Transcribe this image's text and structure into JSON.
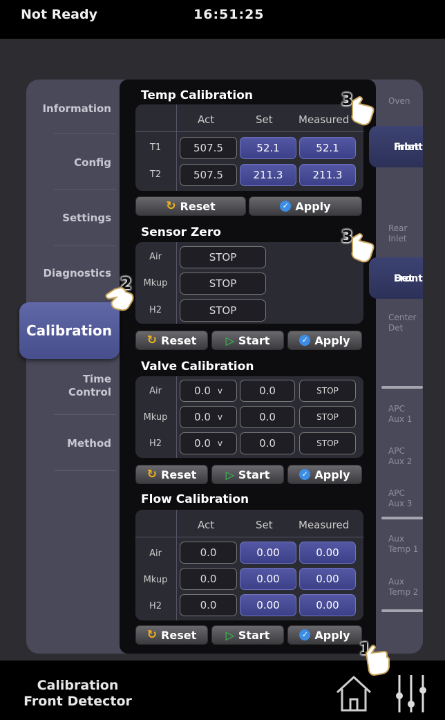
{
  "status": {
    "state": "Not Ready",
    "time": "16:51:25"
  },
  "left_nav": {
    "items": [
      {
        "label": "Information"
      },
      {
        "label": "Config"
      },
      {
        "label": "Settings"
      },
      {
        "label": "Diagnostics"
      },
      {
        "label": "Calibration",
        "active": true
      },
      {
        "label_line1": "Time",
        "label_line2": "Control"
      },
      {
        "label": "Method"
      }
    ]
  },
  "temp_calibration": {
    "title": "Temp Calibration",
    "columns": [
      "Act",
      "Set",
      "Measured"
    ],
    "rows": [
      {
        "label": "T1",
        "act": "507.5",
        "set": "52.1",
        "measured": "52.1"
      },
      {
        "label": "T2",
        "act": "507.5",
        "set": "211.3",
        "measured": "211.3"
      }
    ],
    "buttons": {
      "reset": "Reset",
      "apply": "Apply"
    }
  },
  "sensor_zero": {
    "title": "Sensor Zero",
    "rows": [
      {
        "label": "Air",
        "value": "STOP"
      },
      {
        "label": "Mkup",
        "value": "STOP"
      },
      {
        "label": "H2",
        "value": "STOP"
      }
    ],
    "buttons": {
      "reset": "Reset",
      "start": "Start",
      "apply": "Apply"
    }
  },
  "valve_calibration": {
    "title": "Valve Calibration",
    "rows": [
      {
        "label": "Air",
        "value": "0.0",
        "unit": "v",
        "reading": "0.0",
        "action": "STOP"
      },
      {
        "label": "Mkup",
        "value": "0.0",
        "unit": "v",
        "reading": "0.0",
        "action": "STOP"
      },
      {
        "label": "H2",
        "value": "0.0",
        "unit": "v",
        "reading": "0.0",
        "action": "STOP"
      }
    ],
    "buttons": {
      "reset": "Reset",
      "start": "Start",
      "apply": "Apply"
    }
  },
  "flow_calibration": {
    "title": "Flow Calibration",
    "columns": [
      "Act",
      "Set",
      "Measured"
    ],
    "rows": [
      {
        "label": "Air",
        "act": "0.0",
        "set": "0.00",
        "measured": "0.00"
      },
      {
        "label": "Mkup",
        "act": "0.0",
        "set": "0.00",
        "measured": "0.00"
      },
      {
        "label": "H2",
        "act": "0.0",
        "set": "0.00",
        "measured": "0.00"
      }
    ],
    "buttons": {
      "reset": "Reset",
      "start": "Start",
      "apply": "Apply"
    }
  },
  "right_nav": {
    "items": [
      {
        "line1": "Oven",
        "line2": ""
      },
      {
        "line1": "Front",
        "line2": "Inlet",
        "active": true
      },
      {
        "line1": "Rear",
        "line2": "Inlet"
      },
      {
        "line1": "Front",
        "line2": "Det",
        "active": true
      },
      {
        "line1": "Center",
        "line2": "Det"
      },
      {
        "line1": "APC",
        "line2": "Aux 1"
      },
      {
        "line1": "APC",
        "line2": "Aux 2"
      },
      {
        "line1": "APC",
        "line2": "Aux 3"
      },
      {
        "line1": "Aux",
        "line2": "Temp 1"
      },
      {
        "line1": "Aux",
        "line2": "Temp 2"
      }
    ]
  },
  "bottom": {
    "title_line1": "Calibration",
    "title_line2": "Front Detector"
  },
  "callouts": [
    "1",
    "2",
    "3",
    "3"
  ],
  "icons": {
    "home": "home-icon",
    "settings": "sliders-icon"
  },
  "colors": {
    "accent": "#4a50a0",
    "start": "#2fd34a",
    "reset": "#f0b21c",
    "apply": "#3b8de6"
  }
}
